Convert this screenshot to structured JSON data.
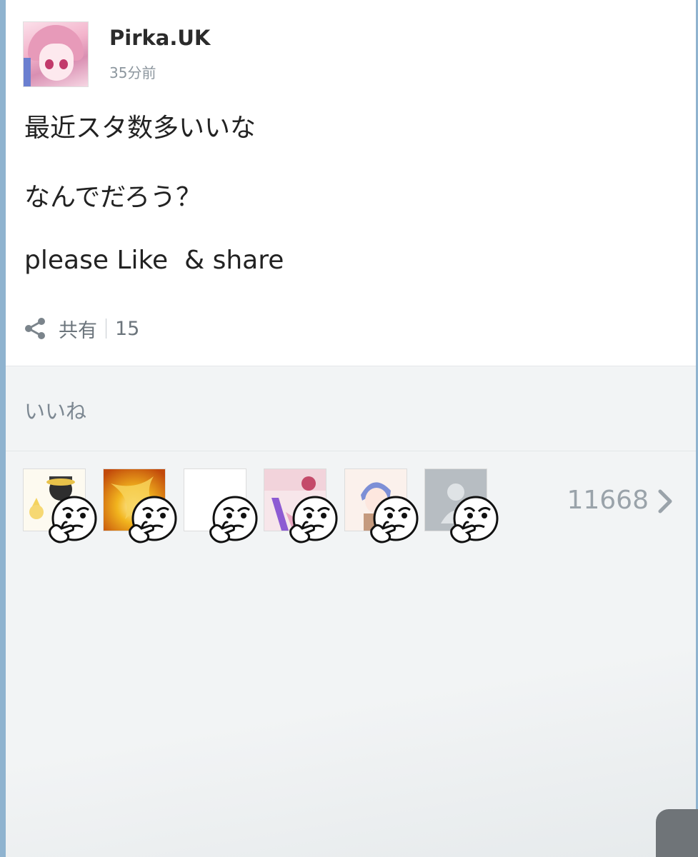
{
  "post": {
    "username": "Pirka.UK",
    "timestamp": "35分前",
    "lines": [
      "最近スタ数多いいな",
      "なんでだろう？",
      "please Like  & share"
    ],
    "share_label": "共有",
    "share_count": "15"
  },
  "likes": {
    "title": "いいね",
    "count": "11668",
    "likers": [
      {
        "avatar": "cartoon-character-avatar",
        "sticker": "thinking-face-sticker"
      },
      {
        "avatar": "golden-phoenix-avatar",
        "sticker": "thinking-face-sticker"
      },
      {
        "avatar": "blank-white-avatar",
        "sticker": "thinking-face-sticker"
      },
      {
        "avatar": "pink-scene-avatar",
        "sticker": "thinking-face-sticker"
      },
      {
        "avatar": "blue-haired-boy-avatar",
        "sticker": "thinking-face-sticker"
      },
      {
        "avatar": "default-silhouette-avatar",
        "sticker": "thinking-face-sticker"
      }
    ]
  },
  "colors": {
    "frame_accent": "#8fb3cf",
    "muted_text": "#8c969e",
    "background": "#f2f4f5"
  }
}
